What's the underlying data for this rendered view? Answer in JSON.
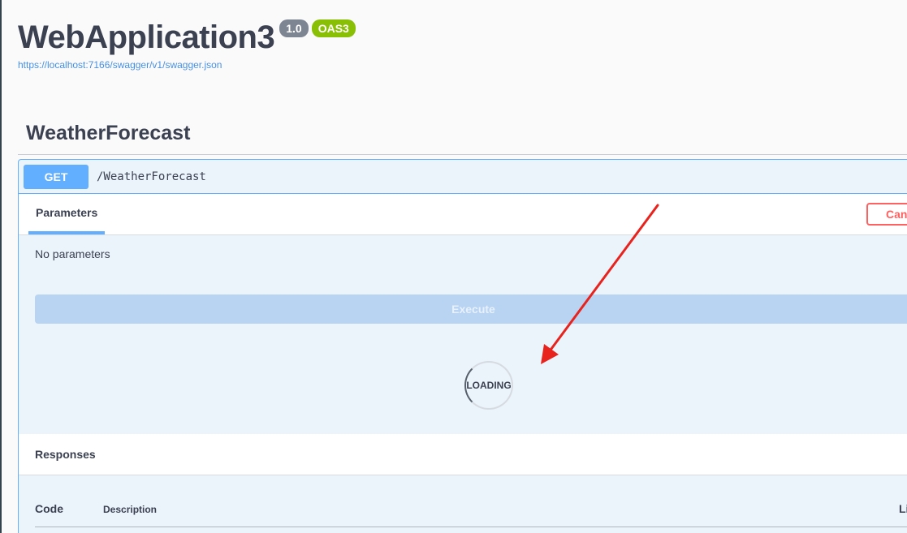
{
  "header": {
    "title": "WebApplication3",
    "version_badge": "1.0",
    "spec_badge": "OAS3",
    "spec_link": "https://localhost:7166/swagger/v1/swagger.json"
  },
  "tag": {
    "name": "WeatherForecast"
  },
  "operation": {
    "method": "GET",
    "path": "/WeatherForecast",
    "parameters_tab": "Parameters",
    "cancel_label": "Cancel",
    "no_parameters": "No parameters",
    "execute_label": "Execute",
    "loading_label": "LOADING",
    "responses_title": "Responses",
    "columns": {
      "code": "Code",
      "description": "Description",
      "links": "Links"
    }
  },
  "colors": {
    "get_method": "#61affe",
    "cancel": "#ff6060",
    "oas_badge": "#89bf04",
    "version_badge": "#7d8492",
    "annotation_arrow": "#e8231d"
  },
  "icons": {
    "loading": "spinner-icon",
    "annotation": "red-arrow-annotation"
  }
}
